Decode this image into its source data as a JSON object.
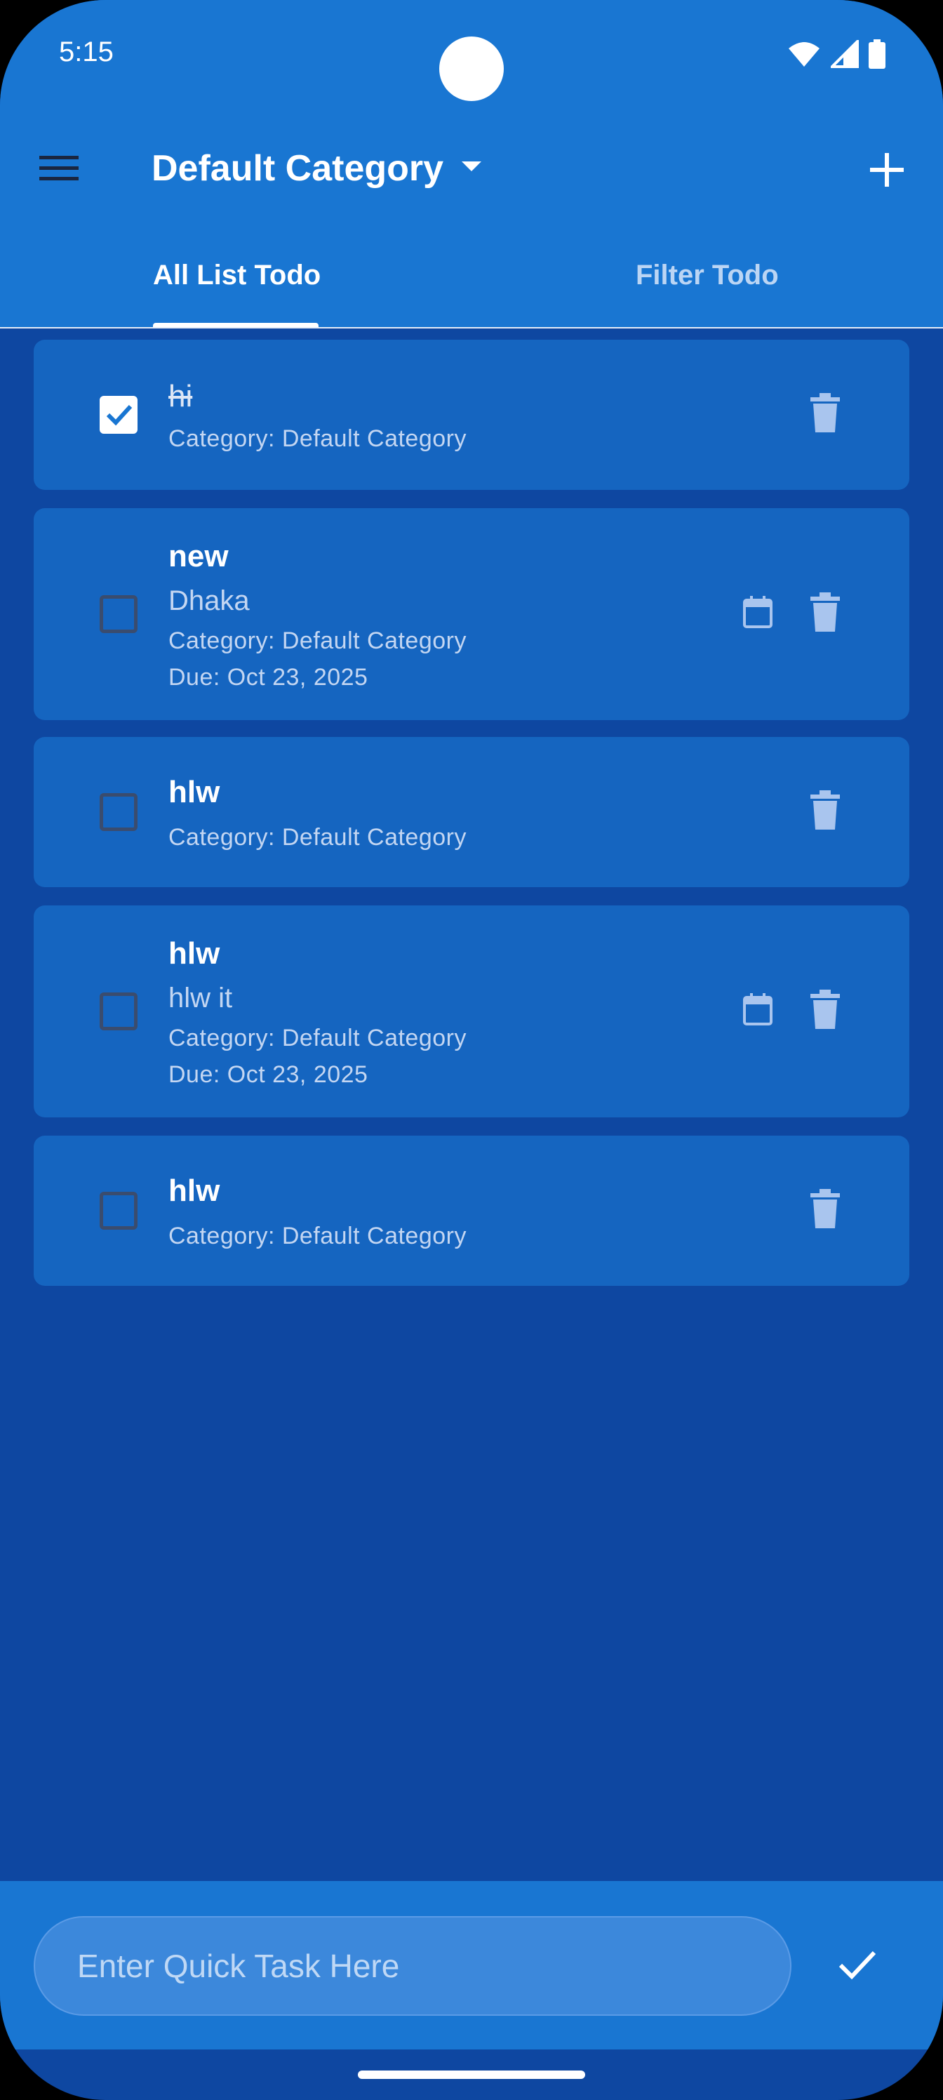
{
  "status_bar": {
    "time": "5:15",
    "icons": [
      "wifi-icon",
      "signal-icon",
      "battery-icon"
    ]
  },
  "app_bar": {
    "menu_icon": "menu-icon",
    "title": "Default Category",
    "dropdown_icon": "dropdown-arrow-icon",
    "add_icon": "plus-icon"
  },
  "tabs": [
    {
      "label": "All List Todo",
      "selected": true
    },
    {
      "label": "Filter Todo",
      "selected": false
    }
  ],
  "todos": [
    {
      "title": "hi",
      "checked": true,
      "category": "Category: Default Category",
      "has_date": false
    },
    {
      "title": "new",
      "checked": false,
      "description": "Dhaka",
      "category": "Category: Default Category",
      "due": "Due: Oct 23, 2025",
      "has_date": true
    },
    {
      "title": "hlw",
      "checked": false,
      "category": "Category: Default Category",
      "has_date": false
    },
    {
      "title": "hlw",
      "checked": false,
      "description": "hlw it",
      "category": "Category: Default Category",
      "due": "Due: Oct 23, 2025",
      "has_date": true
    },
    {
      "title": "hlw",
      "checked": false,
      "category": "Category: Default Category",
      "has_date": false
    }
  ],
  "quick_task": {
    "placeholder": "Enter Quick Task Here",
    "confirm_icon": "check-icon"
  },
  "colors": {
    "app_bar": "#1976D2",
    "background": "#0E47A1",
    "card": "#1565C0",
    "text_primary": "#FFFFFF",
    "text_secondary": "#C3D6F2"
  }
}
